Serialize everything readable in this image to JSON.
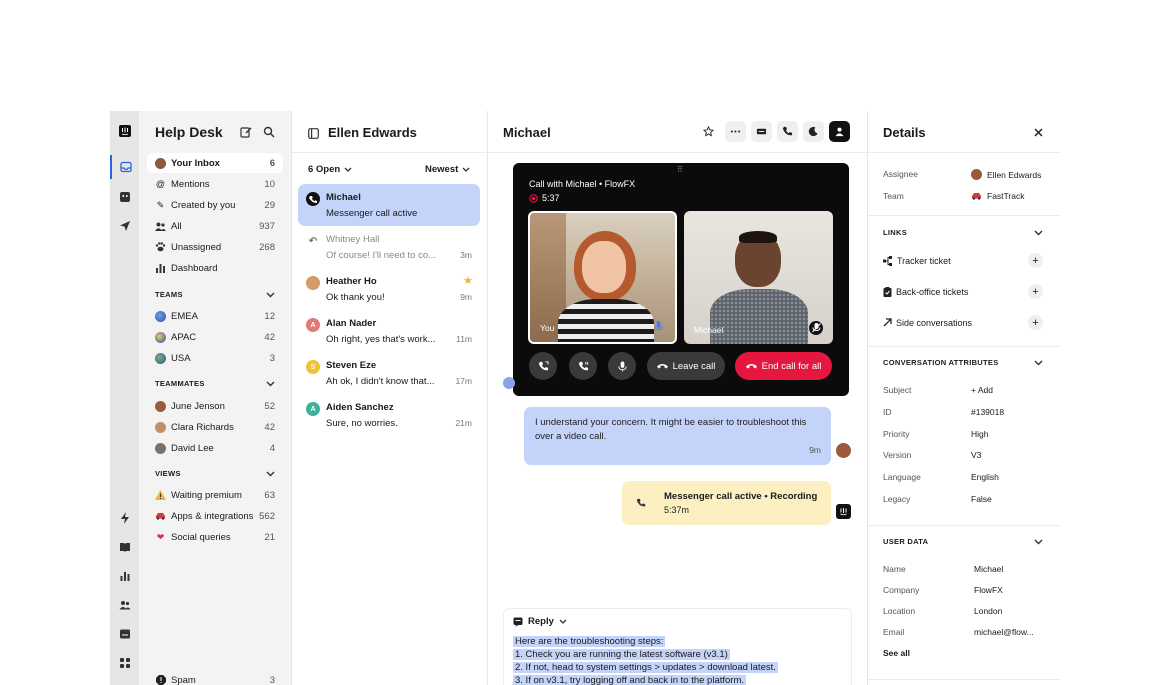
{
  "sidebar": {
    "title": "Help Desk",
    "items": [
      {
        "label": "Your Inbox",
        "count": "6"
      },
      {
        "label": "Mentions",
        "count": "10"
      },
      {
        "label": "Created by you",
        "count": "29"
      },
      {
        "label": "All",
        "count": "937"
      },
      {
        "label": "Unassigned",
        "count": "268"
      },
      {
        "label": "Dashboard",
        "count": ""
      }
    ],
    "teams_heading": "TEAMS",
    "teams": [
      {
        "label": "EMEA",
        "count": "12"
      },
      {
        "label": "APAC",
        "count": "42"
      },
      {
        "label": "USA",
        "count": "3"
      }
    ],
    "teammates_heading": "TEAMMATES",
    "teammates": [
      {
        "label": "June Jenson",
        "count": "52"
      },
      {
        "label": "Clara Richards",
        "count": "42"
      },
      {
        "label": "David Lee",
        "count": "4"
      }
    ],
    "views_heading": "VIEWS",
    "views": [
      {
        "label": "Waiting premium",
        "count": "63"
      },
      {
        "label": "Apps & integrations",
        "count": "562"
      },
      {
        "label": "Social queries",
        "count": "21"
      }
    ],
    "spam": {
      "label": "Spam",
      "count": "3"
    }
  },
  "conversations": {
    "title": "Ellen Edwards",
    "filter_open": "6 Open",
    "sort": "Newest",
    "items": [
      {
        "name": "Michael",
        "preview": "Messenger call active",
        "time": ""
      },
      {
        "name": "Whitney Hall",
        "preview": "Of course! I'll need to co...",
        "time": "3m"
      },
      {
        "name": "Heather Ho",
        "preview": "Ok thank you!",
        "time": "9m"
      },
      {
        "name": "Alan Nader",
        "preview": "Oh right, yes that's work...",
        "time": "11m",
        "initial": "A"
      },
      {
        "name": "Steven Eze",
        "preview": "Ah ok, I didn't know that...",
        "time": "17m",
        "initial": "S"
      },
      {
        "name": "Aiden Sanchez",
        "preview": "Sure, no worries.",
        "time": "21m",
        "initial": "A"
      }
    ]
  },
  "main": {
    "title": "Michael",
    "call": {
      "title": "Call with Michael • FlowFX",
      "timer": "5:37",
      "you_label": "You",
      "michael_label": "Michael",
      "leave_label": "Leave call",
      "end_label": "End call for all"
    },
    "message": {
      "text": "I understand your concern. It might be easier to troubleshoot this over a video call.",
      "time": "9m"
    },
    "recording": {
      "title": "Messenger call active • Recording",
      "time": "5:37m"
    },
    "reply": {
      "label": "Reply",
      "lines": [
        "Here are the troubleshooting steps:",
        " 1. Check you are running the latest software (v3.1)",
        " 2. If not, head to system settings > updates > download latest.",
        " 3. If on v3.1, try logging off and back in to the platform."
      ]
    }
  },
  "details": {
    "title": "Details",
    "assignee_label": "Assignee",
    "assignee_value": "Ellen Edwards",
    "team_label": "Team",
    "team_value": "FastTrack",
    "links_heading": "LINKS",
    "links": [
      "Tracker ticket",
      "Back-office tickets",
      "Side conversations"
    ],
    "attributes_heading": "CONVERSATION ATTRIBUTES",
    "attributes": [
      {
        "key": "Subject",
        "value": "+ Add"
      },
      {
        "key": "ID",
        "value": "#139018"
      },
      {
        "key": "Priority",
        "value": "High"
      },
      {
        "key": "Version",
        "value": "V3"
      },
      {
        "key": "Language",
        "value": "English"
      },
      {
        "key": "Legacy",
        "value": "False"
      }
    ],
    "user_heading": "USER DATA",
    "user": [
      {
        "key": "Name",
        "value": "Michael"
      },
      {
        "key": "Company",
        "value": "FlowFX"
      },
      {
        "key": "Location",
        "value": "London"
      },
      {
        "key": "Email",
        "value": "michael@flow..."
      }
    ],
    "see_all": "See all"
  },
  "colors": {
    "accent": "#2b62e0",
    "selected_bg": "#c4d3fa",
    "recording_bg": "#fcf0c2",
    "end_call": "#e5173f"
  }
}
